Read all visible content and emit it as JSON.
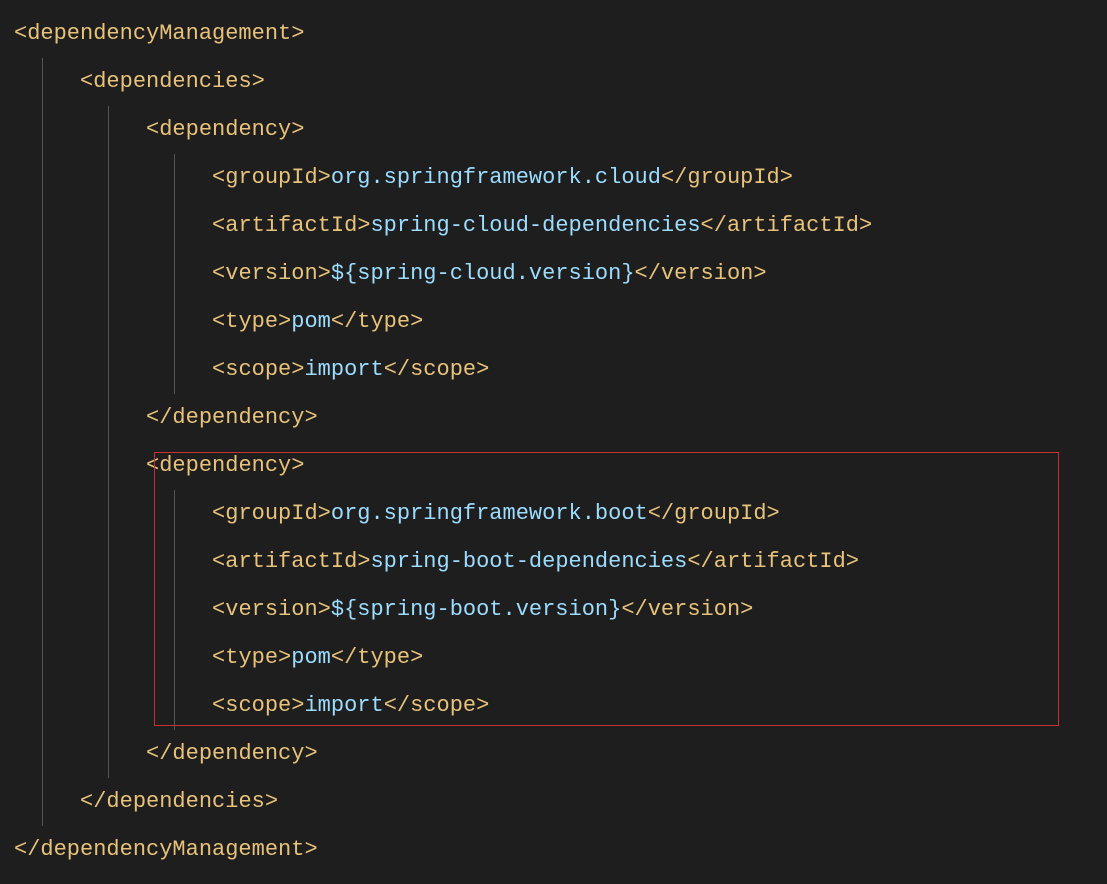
{
  "tags": {
    "dependencyManagement_open": "<dependencyManagement>",
    "dependencyManagement_close": "</dependencyManagement>",
    "dependencies_open": "<dependencies>",
    "dependencies_close": "</dependencies>",
    "dependency_open": "<dependency>",
    "dependency_close": "</dependency>",
    "groupId_open": "<groupId>",
    "groupId_close": "</groupId>",
    "artifactId_open": "<artifactId>",
    "artifactId_close": "</artifactId>",
    "version_open": "<version>",
    "version_close": "</version>",
    "type_open": "<type>",
    "type_close": "</type>",
    "scope_open": "<scope>",
    "scope_close": "</scope>"
  },
  "dep1": {
    "groupId": "org.springframework.cloud",
    "artifactId": "spring-cloud-dependencies",
    "version": "${spring-cloud.version}",
    "type": "pom",
    "scope": "import"
  },
  "dep2": {
    "groupId": "org.springframework.boot",
    "artifactId": "spring-boot-dependencies",
    "version": "${spring-boot.version}",
    "type": "pom",
    "scope": "import"
  }
}
